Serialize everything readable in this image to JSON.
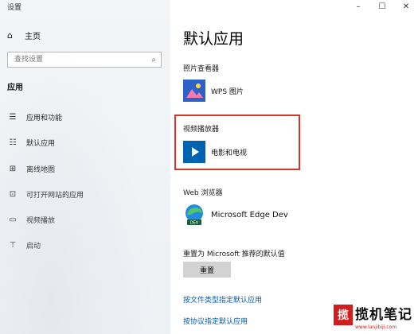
{
  "window": {
    "title": "设置",
    "controls": {
      "minimize": "–",
      "maximize": "☐",
      "close": "✕"
    }
  },
  "sidebar": {
    "home": {
      "icon": "home-icon",
      "label": "主页"
    },
    "search": {
      "placeholder": "查找设置",
      "icon": "search-icon"
    },
    "section_label": "应用",
    "items": [
      {
        "icon": "apps-features-icon",
        "label": "应用和功能"
      },
      {
        "icon": "default-apps-icon",
        "label": "默认应用"
      },
      {
        "icon": "offline-maps-icon",
        "label": "离线地图"
      },
      {
        "icon": "apps-for-websites-icon",
        "label": "可打开网站的应用"
      },
      {
        "icon": "video-playback-icon",
        "label": "视频播放"
      },
      {
        "icon": "startup-icon",
        "label": "启动"
      }
    ]
  },
  "main": {
    "title": "默认应用",
    "photo_viewer": {
      "label": "照片查看器",
      "app": "WPS 图片"
    },
    "video_player": {
      "label": "视频播放器",
      "app": "电影和电视"
    },
    "web_browser": {
      "label": "Web 浏览器",
      "app": "Microsoft Edge Dev",
      "badge": "DEV"
    },
    "reset": {
      "label": "重置为 Microsoft 推荐的默认值",
      "button": "重置"
    },
    "links": [
      "按文件类型指定默认应用",
      "按协议指定默认应用"
    ]
  },
  "watermark": {
    "logo_char": "揽",
    "text": "揽机笔记",
    "url": "www.lanjibiji.com"
  },
  "colors": {
    "highlight_border": "#d9342b",
    "link": "#0b5cad",
    "accent": "#0067c0"
  }
}
